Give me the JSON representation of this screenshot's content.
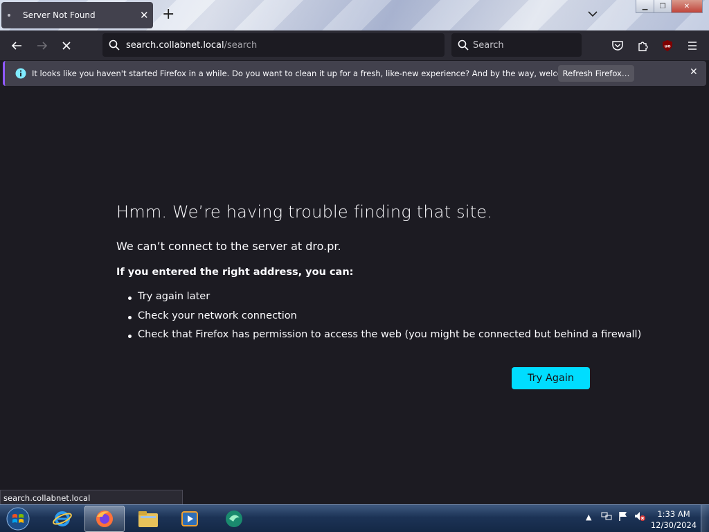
{
  "browser": {
    "tab": {
      "title": "Server Not Found",
      "close": "✕"
    },
    "new_tab": "+",
    "url_host": "search.collabnet.local",
    "url_path": "/search",
    "search_placeholder": "Search",
    "addon_badge": "uo"
  },
  "notification": {
    "message": "It looks like you haven't started Firefox in a while. Do you want to clean it up for a fresh, like-new experience? And by the way, welcome back!",
    "button": "Refresh Firefox…"
  },
  "error_page": {
    "title": "Hmm. We’re having trouble finding that site.",
    "subtitle": "We can’t connect to the server at dro.pr.",
    "lead": "If you entered the right address, you can:",
    "suggestions": [
      "Try again later",
      "Check your network connection",
      "Check that Firefox has permission to access the web (you might be connected but behind a firewall)"
    ],
    "try_again": "Try Again"
  },
  "status_bar": "search.collabnet.local",
  "taskbar": {
    "time": "1:33 AM",
    "date": "12/30/2024"
  },
  "colors": {
    "accent": "#00ddff",
    "page_bg": "#1c1b22",
    "toolbar": "#2b2a33",
    "notification_bg": "#42414d"
  }
}
